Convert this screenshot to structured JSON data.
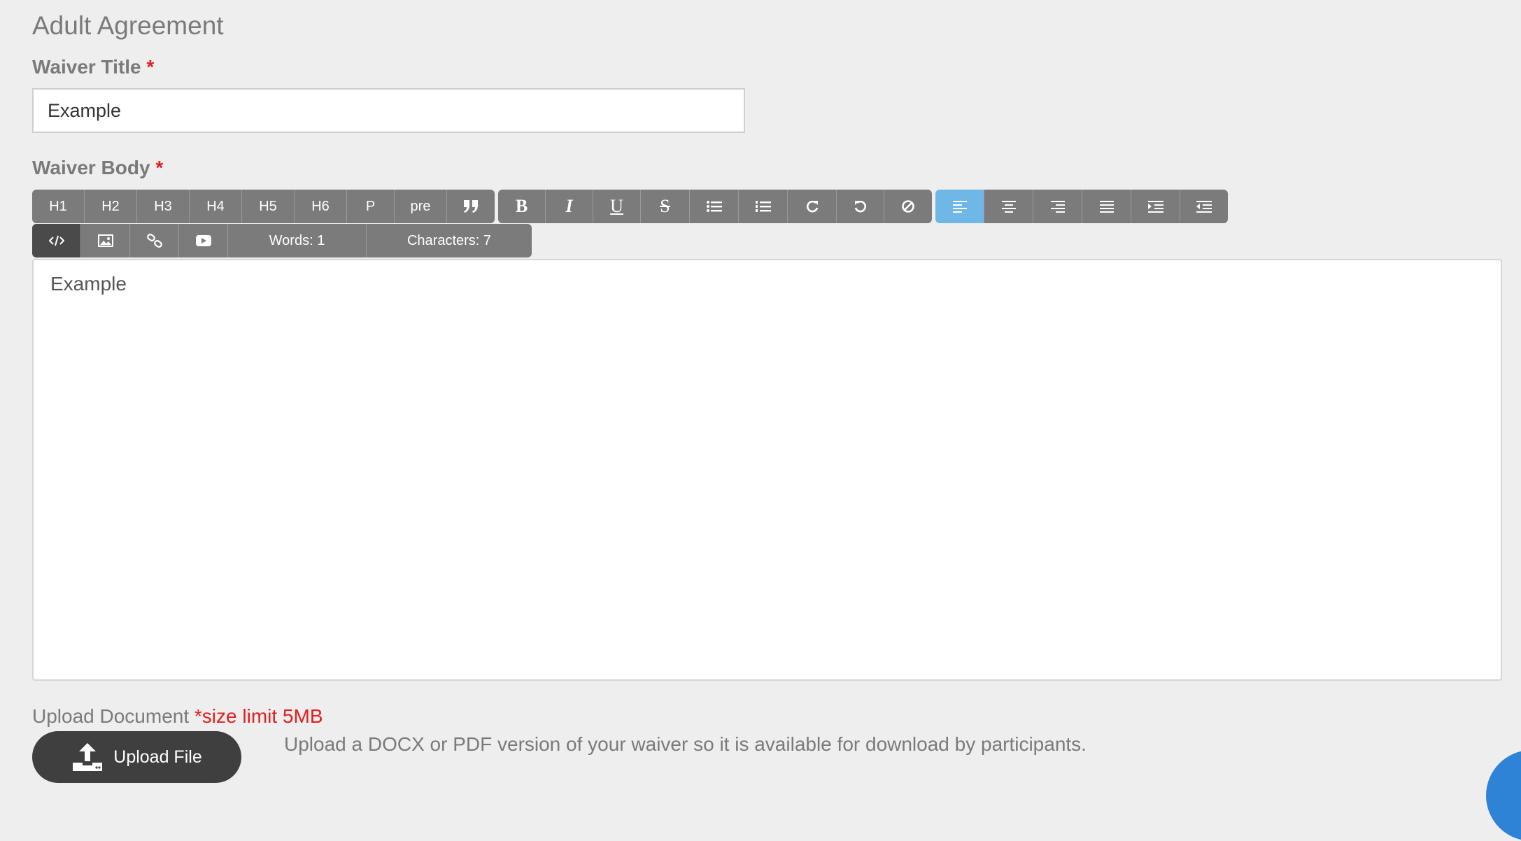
{
  "section": {
    "title": "Adult Agreement"
  },
  "waiver_title": {
    "label": "Waiver Title",
    "required_mark": "*",
    "value": "Example"
  },
  "waiver_body": {
    "label": "Waiver Body",
    "required_mark": "*",
    "toolbar": {
      "headings": [
        "H1",
        "H2",
        "H3",
        "H4",
        "H5",
        "H6",
        "P",
        "pre"
      ],
      "bold_label": "B",
      "italic_label": "I",
      "underline_label": "U",
      "strike_label": "S",
      "words": "Words: 1",
      "characters": "Characters: 7",
      "active_alignment": "align-left"
    },
    "content": "Example"
  },
  "upload": {
    "label": "Upload Document",
    "size_limit": "*size limit 5MB",
    "button_label": "Upload File",
    "hint": "Upload a DOCX or PDF version of your waiver so it is available for download by participants."
  },
  "colors": {
    "accent": "#6fb7e7",
    "required": "#e02020",
    "fab": "#2f83d6"
  }
}
